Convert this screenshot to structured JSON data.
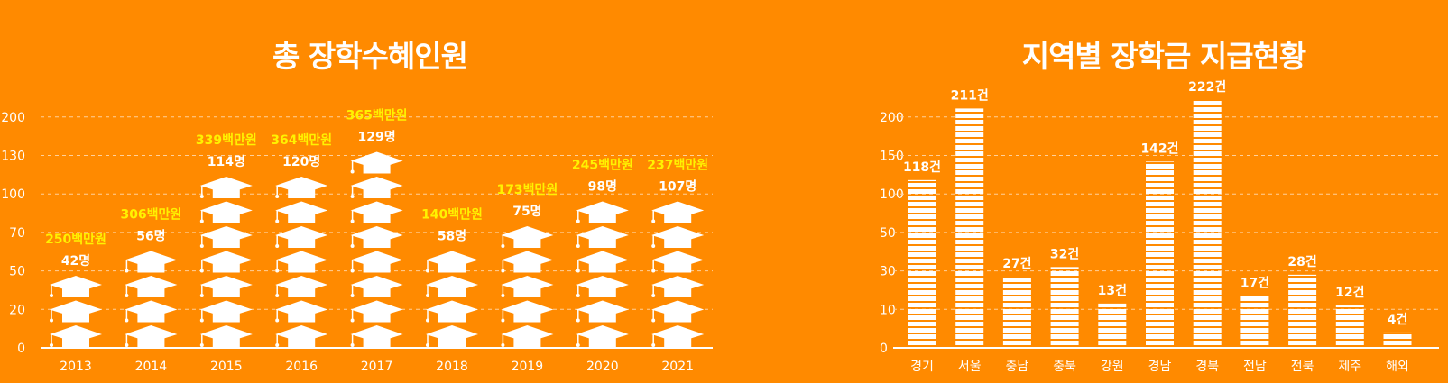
{
  "chart_data": [
    {
      "type": "bar",
      "title": "총 장학수혜인원",
      "categories": [
        "2013",
        "2014",
        "2015",
        "2016",
        "2017",
        "2018",
        "2019",
        "2020",
        "2021"
      ],
      "values": [
        42,
        56,
        114,
        120,
        129,
        58,
        75,
        98,
        107
      ],
      "value_labels": [
        "42명",
        "56명",
        "114명",
        "120명",
        "129명",
        "58명",
        "75명",
        "98명",
        "107명"
      ],
      "amount_labels": [
        "250백만원",
        "306백만원",
        "339백만원",
        "364백만원",
        "365백만원",
        "140백만원",
        "173백만원",
        "245백만원",
        "237백만원"
      ],
      "icon_stack": [
        3,
        4,
        7,
        7,
        8,
        4,
        5,
        6,
        6
      ],
      "y_ticks": [
        "0",
        "20",
        "50",
        "70",
        "100",
        "130",
        "200"
      ],
      "grid": "dashed horizontal",
      "colors": {
        "bar": "#FFFFFF",
        "value_label": "#FFFFFF",
        "amount_label": "#FFF200",
        "background": "#FF8A00"
      }
    },
    {
      "type": "bar",
      "title": "지역별 장학금 지급현황",
      "categories": [
        "경기",
        "서울",
        "충남",
        "충북",
        "강원",
        "경남",
        "경북",
        "전남",
        "전북",
        "제주",
        "해외"
      ],
      "values": [
        118,
        211,
        27,
        32,
        13,
        142,
        222,
        17,
        28,
        12,
        4
      ],
      "value_labels": [
        "118건",
        "211건",
        "27건",
        "32건",
        "13건",
        "142건",
        "222건",
        "17건",
        "28건",
        "12건",
        "4건"
      ],
      "y_ticks": [
        "0",
        "10",
        "30",
        "50",
        "100",
        "150",
        "200"
      ],
      "grid": "dashed horizontal",
      "colors": {
        "bar": "#FFFFFF",
        "background": "#FF8A00"
      }
    }
  ]
}
